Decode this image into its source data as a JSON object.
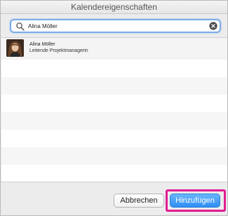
{
  "window": {
    "title": "Kalendereigenschaften"
  },
  "search": {
    "value": "Alina Möller",
    "placeholder": ""
  },
  "results": [
    {
      "name": "Alina Möller",
      "title": "Leitende Projektmanagerin"
    }
  ],
  "footer": {
    "cancel_label": "Abbrechen",
    "add_label": "Hinzufügen"
  },
  "colors": {
    "accent": "#2d8ef4",
    "highlight": "#e21c93",
    "search_focus": "#7cabe8"
  },
  "icons": {
    "search": "search-icon",
    "clear": "clear-icon"
  }
}
